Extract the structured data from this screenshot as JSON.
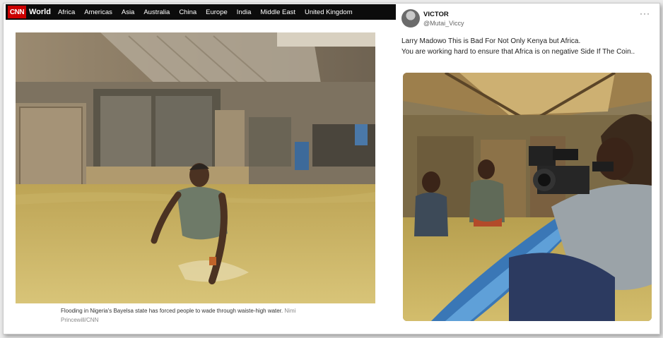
{
  "cnn": {
    "logo": "CNN",
    "section": "World",
    "nav": [
      "Africa",
      "Americas",
      "Asia",
      "Australia",
      "China",
      "Europe",
      "India",
      "Middle East",
      "United Kingdom"
    ],
    "caption": "Flooding in Nigeria's Bayelsa state has forced people to wade through waiste-high water.",
    "credit": "Nimi Princewill/CNN",
    "photo_icon": "flood-wading-woman-photo"
  },
  "tweet": {
    "name": "VICTOR",
    "handle": "@Mutai_Viccy",
    "more": "···",
    "line1": "Larry Madowo This is Bad For Not Only Kenya but Africa.",
    "line2": "You are working hard to ensure that Africa is on negative Side If The Coin..",
    "photo_icon": "film-crew-flood-photo"
  },
  "colors": {
    "cnn_red": "#cc0000",
    "nav_bg": "#0c0c0c",
    "water": "#c9b56a"
  }
}
